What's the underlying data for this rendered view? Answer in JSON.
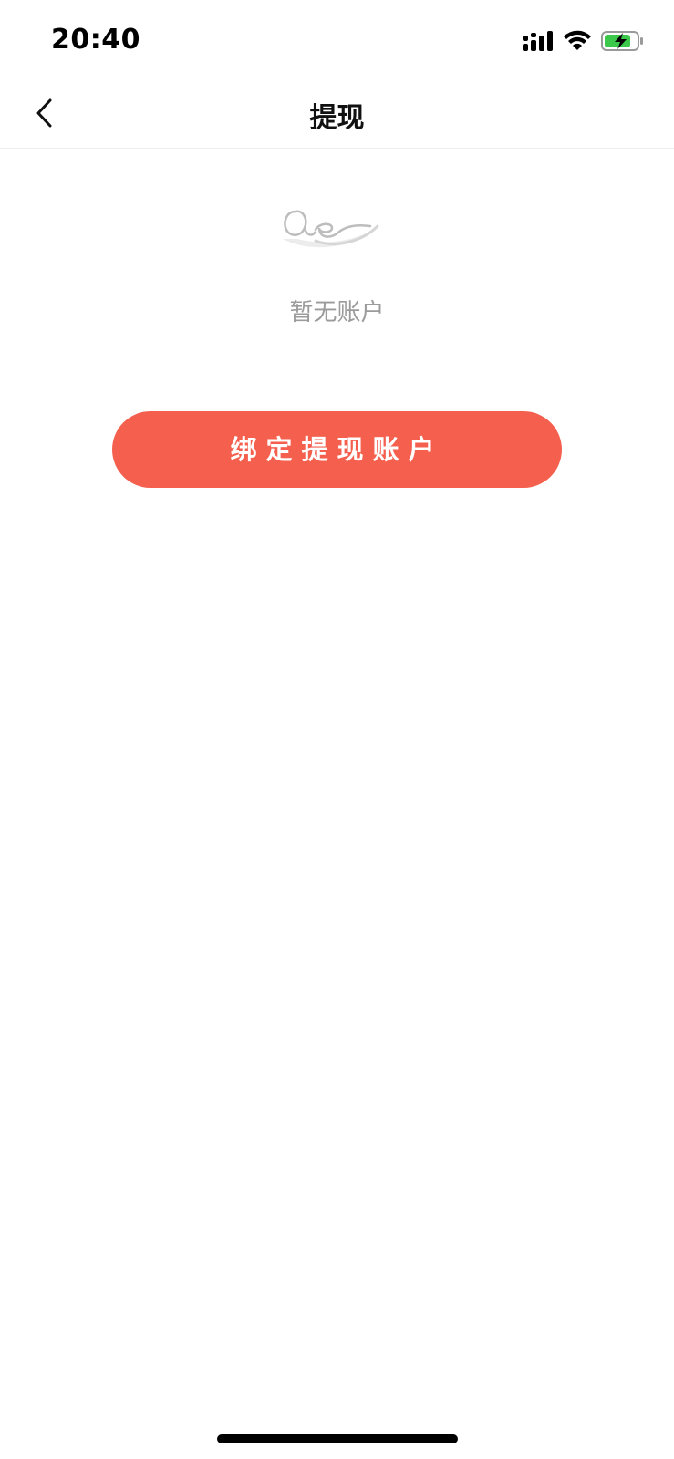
{
  "status_bar": {
    "time": "20:40",
    "icons": [
      "cellular-signal-icon",
      "wifi-icon",
      "battery-charging-icon"
    ],
    "battery_color": "#3cc84b"
  },
  "nav": {
    "title": "提现",
    "back_icon": "chevron-left-icon"
  },
  "empty_state": {
    "illustration": "empty-scribble-illustration",
    "text": "暂无账户"
  },
  "primary_action": {
    "label": "绑定提现账户",
    "color": "#f45f4e"
  }
}
